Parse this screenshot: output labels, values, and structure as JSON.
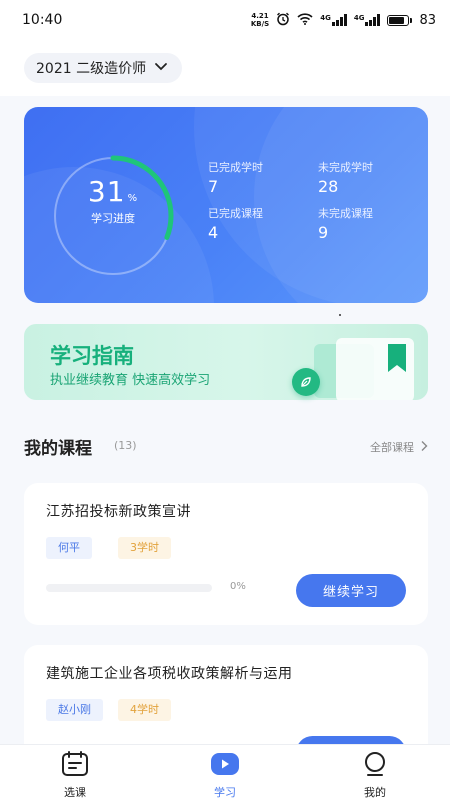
{
  "status_bar": {
    "time": "10:40",
    "net_speed_value": "4.21",
    "net_speed_unit": "KB/S",
    "signal_a": "4G",
    "signal_b": "4G",
    "battery": "83",
    "battery_level": 0.83
  },
  "exam_selector": {
    "label": "2021 二级造价师"
  },
  "progress": {
    "percent_value": "31",
    "percent_sign": "%",
    "percent_fraction": 0.31,
    "label": "学习进度",
    "stats": [
      {
        "label": "已完成学时",
        "value": "7"
      },
      {
        "label": "未完成学时",
        "value": "28"
      },
      {
        "label": "已完成课程",
        "value": "4"
      },
      {
        "label": "未完成课程",
        "value": "9"
      }
    ],
    "colors": {
      "ring_progress": "#1fc57a",
      "card_start": "#3f6ff2",
      "card_end": "#5a97fb"
    }
  },
  "guide_banner": {
    "title": "学习指南",
    "subtitle": "执业继续教育 快速高效学习",
    "accent": "#17b07c"
  },
  "my_courses": {
    "title": "我的课程",
    "count": "(13)",
    "all_link": "全部课程",
    "items": [
      {
        "title": "江苏招投标新政策宣讲",
        "teacher": "何平",
        "hours": "3学时",
        "progress_text": "0%",
        "progress": 0,
        "button": "继续学习"
      },
      {
        "title": "建筑施工企业各项税收政策解析与运用",
        "teacher": "赵小刚",
        "hours": "4学时",
        "progress_text": "",
        "progress": 0,
        "button": ""
      }
    ]
  },
  "tabbar": {
    "items": [
      {
        "label": "选课",
        "icon": "calendar-icon",
        "active": false
      },
      {
        "label": "学习",
        "icon": "play-icon",
        "active": true
      },
      {
        "label": "我的",
        "icon": "user-icon",
        "active": false
      }
    ],
    "active_color": "#4677ee"
  }
}
